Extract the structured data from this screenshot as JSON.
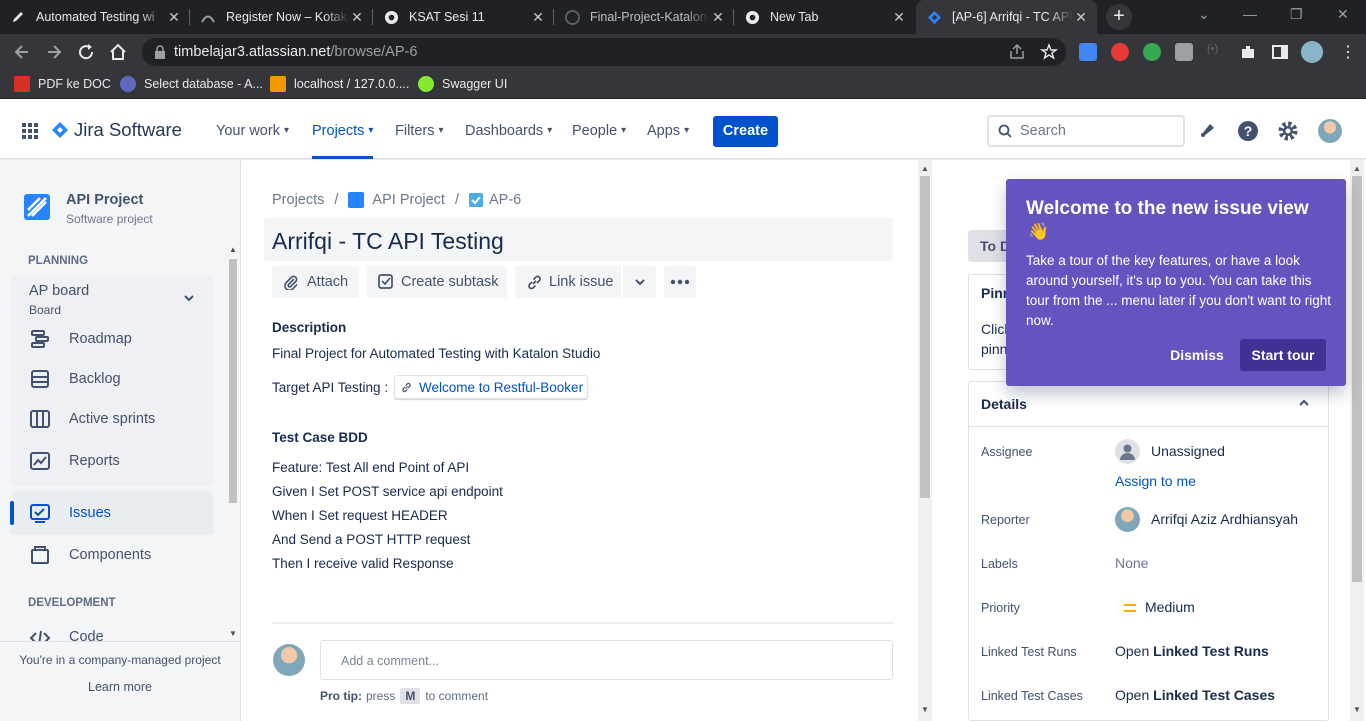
{
  "browser": {
    "tabs": [
      {
        "title": "Automated Testing wi",
        "icon": "pen-icon"
      },
      {
        "title": "Register Now – Kotakode",
        "icon": "kotakode-icon"
      },
      {
        "title": "KSAT Sesi 11",
        "icon": "chrome-icon"
      },
      {
        "title": "Final-Project-Katalon-",
        "icon": "github-icon"
      },
      {
        "title": "New Tab",
        "icon": "chrome-icon"
      },
      {
        "title": "[AP-6] Arrifqi - TC API",
        "icon": "jira-icon",
        "active": true
      }
    ],
    "url_host": "timbelajar3.atlassian.net",
    "url_path": "/browse/AP-6",
    "bookmarks": [
      {
        "label": "PDF ke DOC"
      },
      {
        "label": "Select database - A..."
      },
      {
        "label": "localhost / 127.0.0...."
      },
      {
        "label": "Swagger UI"
      }
    ]
  },
  "nav": {
    "product": "Jira Software",
    "items": [
      {
        "label": "Your work"
      },
      {
        "label": "Projects"
      },
      {
        "label": "Filters"
      },
      {
        "label": "Dashboards"
      },
      {
        "label": "People"
      },
      {
        "label": "Apps"
      }
    ],
    "create": "Create",
    "search_placeholder": "Search"
  },
  "sidebar": {
    "project_name": "API Project",
    "project_type": "Software project",
    "planning_heading": "PLANNING",
    "board_name": "AP board",
    "board_sub": "Board",
    "items": [
      {
        "label": "Roadmap"
      },
      {
        "label": "Backlog"
      },
      {
        "label": "Active sprints"
      },
      {
        "label": "Reports"
      }
    ],
    "issues": "Issues",
    "components": "Components",
    "development_heading": "DEVELOPMENT",
    "code": "Code",
    "footer_text": "You're in a company-managed project",
    "learn_more": "Learn more"
  },
  "issue": {
    "breadcrumb": {
      "projects": "Projects",
      "project": "API Project",
      "key": "AP-6"
    },
    "title": "Arrifqi - TC API Testing",
    "actions": {
      "attach": "Attach",
      "subtask": "Create subtask",
      "link": "Link issue"
    },
    "description_label": "Description",
    "description": "Final Project for Automated Testing with Katalon Studio",
    "target_label": "Target API Testing :",
    "target_link": "Welcome to Restful-Booker",
    "bdd_heading": "Test Case BDD",
    "bdd_lines": [
      "Feature: Test All end Point of API",
      "Given I Set POST service api endpoint",
      "When I Set request HEADER",
      "And Send a POST HTTP request",
      "Then I receive valid Response"
    ],
    "comment_placeholder": "Add a comment...",
    "pro_tip_label": "Pro tip:",
    "pro_tip_press": "press",
    "pro_tip_key": "M",
    "pro_tip_rest": "to comment"
  },
  "details": {
    "status_button": "To D",
    "pinned_label": "Pinn",
    "pinned_text_1": "Click",
    "pinned_text_2": "pinn",
    "heading": "Details",
    "assignee_label": "Assignee",
    "assignee_value": "Unassigned",
    "assign_to_me": "Assign to me",
    "reporter_label": "Reporter",
    "reporter_value": "Arrifqi Aziz Ardhiansyah",
    "labels_label": "Labels",
    "labels_value": "None",
    "priority_label": "Priority",
    "priority_value": "Medium",
    "runs_label": "Linked Test Runs",
    "runs_prefix": "Open",
    "runs_value": "Linked Test Runs",
    "cases_label": "Linked Test Cases",
    "cases_prefix": "Open",
    "cases_value": "Linked Test Cases"
  },
  "tour": {
    "title": "Welcome to the new issue view",
    "emoji": "👋",
    "body": "Take a tour of the key features, or have a look around yourself, it's up to you. You can take this tour from the ... menu later if you don't want to right now.",
    "dismiss": "Dismiss",
    "start": "Start tour"
  },
  "colors": {
    "brand": "#0052cc",
    "tour": "#6554c0",
    "priority": "#ffab00"
  }
}
